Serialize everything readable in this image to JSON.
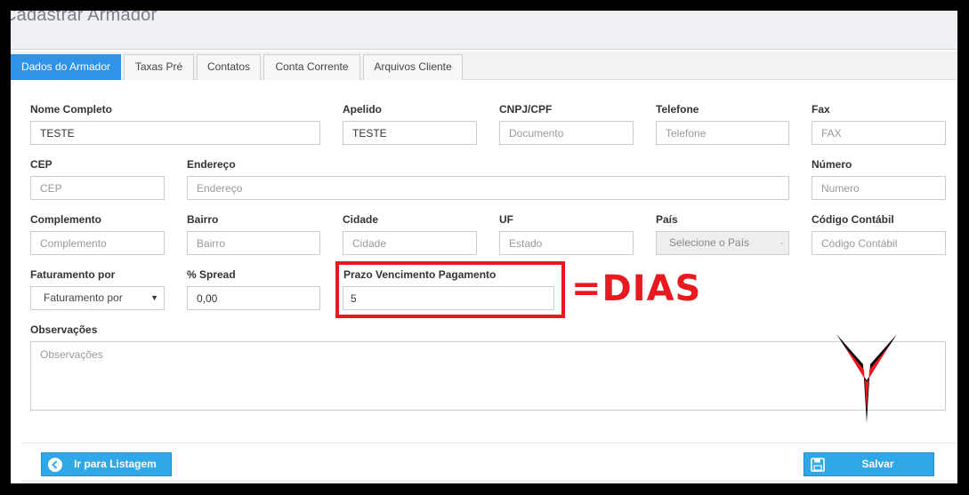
{
  "page": {
    "title": "Cadastrar Armador"
  },
  "tabs": [
    "Dados do Armador",
    "Taxas Pré",
    "Contatos",
    "Conta Corrente",
    "Arquivos Cliente"
  ],
  "fields": {
    "nome_completo": {
      "label": "Nome Completo",
      "value": "TESTE",
      "placeholder": ""
    },
    "apelido": {
      "label": "Apelido",
      "value": "TESTE",
      "placeholder": ""
    },
    "cnpj": {
      "label": "CNPJ/CPF",
      "value": "",
      "placeholder": "Documento"
    },
    "telefone": {
      "label": "Telefone",
      "value": "",
      "placeholder": "Telefone"
    },
    "fax": {
      "label": "Fax",
      "value": "",
      "placeholder": "FAX"
    },
    "cep": {
      "label": "CEP",
      "value": "",
      "placeholder": "CEP"
    },
    "endereco": {
      "label": "Endereço",
      "value": "",
      "placeholder": "Endereço"
    },
    "numero": {
      "label": "Número",
      "value": "",
      "placeholder": "Numero"
    },
    "complemento": {
      "label": "Complemento",
      "value": "",
      "placeholder": "Complemento"
    },
    "bairro": {
      "label": "Bairro",
      "value": "",
      "placeholder": "Bairro"
    },
    "cidade": {
      "label": "Cidade",
      "value": "",
      "placeholder": "Cidade"
    },
    "uf": {
      "label": "UF",
      "value": "",
      "placeholder": "Estado"
    },
    "pais": {
      "label": "País",
      "selected": "Selecione o País"
    },
    "codigo_contabil": {
      "label": "Código Contábil",
      "value": "",
      "placeholder": "Código Contábil"
    },
    "faturamento": {
      "label": "Faturamento por",
      "selected": "Faturamento por"
    },
    "spread": {
      "label": "% Spread",
      "value": "0,00",
      "placeholder": ""
    },
    "prazo": {
      "label": "Prazo Vencimento Pagamento",
      "value": "5",
      "placeholder": ""
    },
    "observacoes": {
      "label": "Observações",
      "value": "",
      "placeholder": "Observações"
    }
  },
  "annotation": {
    "text": "=DIAS",
    "color": "#e8191f"
  },
  "buttons": {
    "listagem": "Ir para Listagem",
    "salvar": "Salvar"
  },
  "icons": {
    "listagem": "arrow-left-circle-icon",
    "salvar": "floppy-disk-icon",
    "annotation": "red-down-arrow-icon"
  },
  "colors": {
    "accent": "#2f93e8",
    "button": "#2ea8e6",
    "annotation": "#e8191f"
  }
}
